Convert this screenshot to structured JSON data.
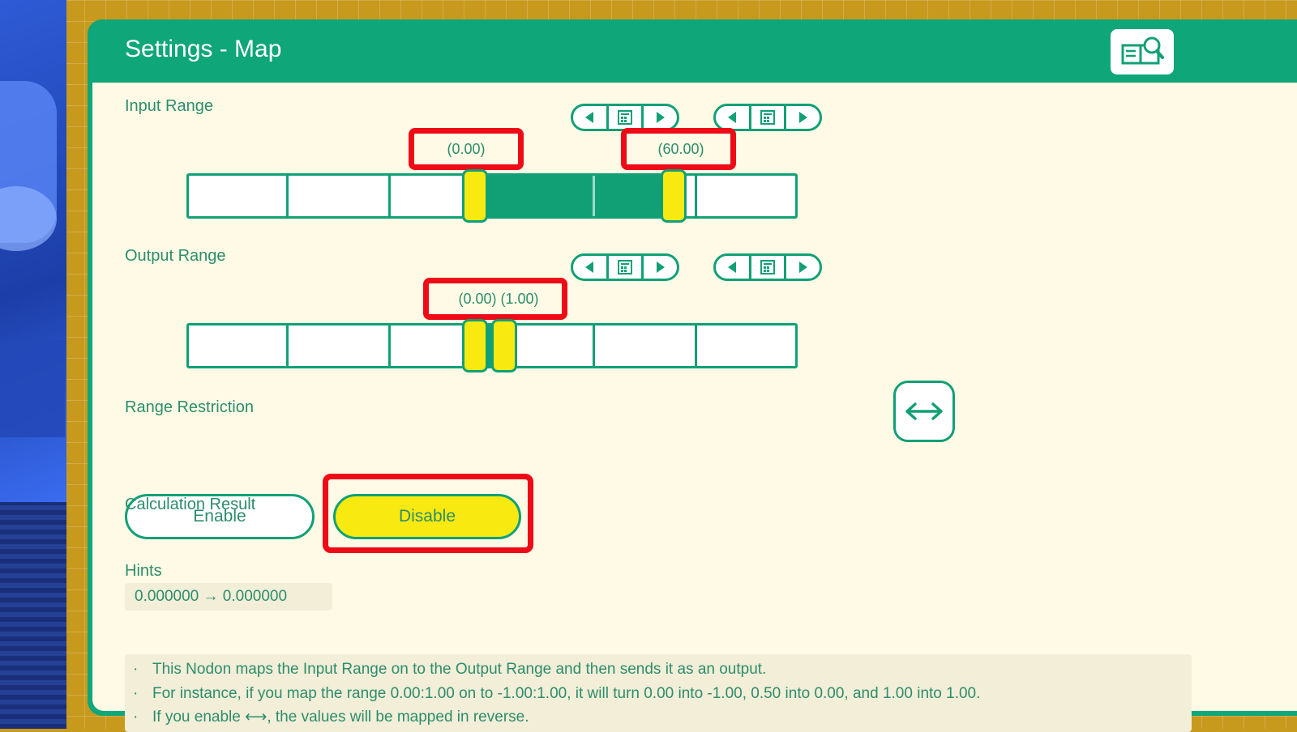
{
  "window": {
    "title": "Settings - Map",
    "help_icon": "manual-search-icon"
  },
  "input_range": {
    "label": "Input Range",
    "min_value_text": "(0.00)",
    "max_value_text": "(60.00)",
    "min_fraction": 0.45,
    "max_fraction": 0.8
  },
  "output_range": {
    "label": "Output Range",
    "value_text": "(0.00)  (1.00)",
    "min_fraction": 0.45,
    "max_fraction": 0.52,
    "reverse_icon": "left-right-arrow-icon"
  },
  "stepper_icons": {
    "left": "triangle-left-icon",
    "middle": "calculator-icon",
    "right": "triangle-right-icon"
  },
  "range_restriction": {
    "label": "Range Restriction",
    "enable_label": "Enable",
    "disable_label": "Disable",
    "selected": "Disable"
  },
  "calculation": {
    "label": "Calculation Result",
    "value": "0.000000 → 0.000000"
  },
  "hints": {
    "label": "Hints",
    "bullet": "·",
    "lines": [
      "This Nodon maps the Input Range on to the Output Range and then sends it as an output.",
      "For instance, if you map the range 0.00:1.00 on to -1.00:1.00, it will turn 0.00 into -1.00, 0.50 into 0.00, and 1.00 into 1.00.",
      "If you enable ⟷, the values will be mapped in reverse."
    ]
  },
  "colors": {
    "accent_green": "#0fa679",
    "handle_yellow": "#f8ea10",
    "panel_bg": "#fefae6",
    "highlight_red": "#ee0a16"
  }
}
